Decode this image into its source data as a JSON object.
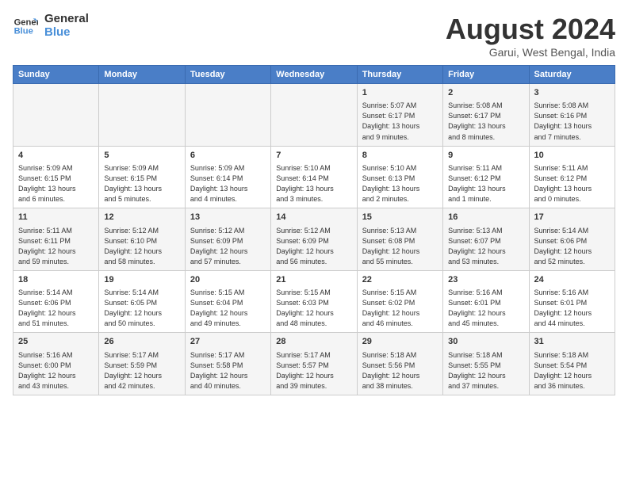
{
  "logo": {
    "line1": "General",
    "line2": "Blue"
  },
  "title": "August 2024",
  "subtitle": "Garui, West Bengal, India",
  "days_of_week": [
    "Sunday",
    "Monday",
    "Tuesday",
    "Wednesday",
    "Thursday",
    "Friday",
    "Saturday"
  ],
  "weeks": [
    [
      {
        "day": "",
        "content": ""
      },
      {
        "day": "",
        "content": ""
      },
      {
        "day": "",
        "content": ""
      },
      {
        "day": "",
        "content": ""
      },
      {
        "day": "1",
        "content": "Sunrise: 5:07 AM\nSunset: 6:17 PM\nDaylight: 13 hours\nand 9 minutes."
      },
      {
        "day": "2",
        "content": "Sunrise: 5:08 AM\nSunset: 6:17 PM\nDaylight: 13 hours\nand 8 minutes."
      },
      {
        "day": "3",
        "content": "Sunrise: 5:08 AM\nSunset: 6:16 PM\nDaylight: 13 hours\nand 7 minutes."
      }
    ],
    [
      {
        "day": "4",
        "content": "Sunrise: 5:09 AM\nSunset: 6:15 PM\nDaylight: 13 hours\nand 6 minutes."
      },
      {
        "day": "5",
        "content": "Sunrise: 5:09 AM\nSunset: 6:15 PM\nDaylight: 13 hours\nand 5 minutes."
      },
      {
        "day": "6",
        "content": "Sunrise: 5:09 AM\nSunset: 6:14 PM\nDaylight: 13 hours\nand 4 minutes."
      },
      {
        "day": "7",
        "content": "Sunrise: 5:10 AM\nSunset: 6:14 PM\nDaylight: 13 hours\nand 3 minutes."
      },
      {
        "day": "8",
        "content": "Sunrise: 5:10 AM\nSunset: 6:13 PM\nDaylight: 13 hours\nand 2 minutes."
      },
      {
        "day": "9",
        "content": "Sunrise: 5:11 AM\nSunset: 6:12 PM\nDaylight: 13 hours\nand 1 minute."
      },
      {
        "day": "10",
        "content": "Sunrise: 5:11 AM\nSunset: 6:12 PM\nDaylight: 13 hours\nand 0 minutes."
      }
    ],
    [
      {
        "day": "11",
        "content": "Sunrise: 5:11 AM\nSunset: 6:11 PM\nDaylight: 12 hours\nand 59 minutes."
      },
      {
        "day": "12",
        "content": "Sunrise: 5:12 AM\nSunset: 6:10 PM\nDaylight: 12 hours\nand 58 minutes."
      },
      {
        "day": "13",
        "content": "Sunrise: 5:12 AM\nSunset: 6:09 PM\nDaylight: 12 hours\nand 57 minutes."
      },
      {
        "day": "14",
        "content": "Sunrise: 5:12 AM\nSunset: 6:09 PM\nDaylight: 12 hours\nand 56 minutes."
      },
      {
        "day": "15",
        "content": "Sunrise: 5:13 AM\nSunset: 6:08 PM\nDaylight: 12 hours\nand 55 minutes."
      },
      {
        "day": "16",
        "content": "Sunrise: 5:13 AM\nSunset: 6:07 PM\nDaylight: 12 hours\nand 53 minutes."
      },
      {
        "day": "17",
        "content": "Sunrise: 5:14 AM\nSunset: 6:06 PM\nDaylight: 12 hours\nand 52 minutes."
      }
    ],
    [
      {
        "day": "18",
        "content": "Sunrise: 5:14 AM\nSunset: 6:06 PM\nDaylight: 12 hours\nand 51 minutes."
      },
      {
        "day": "19",
        "content": "Sunrise: 5:14 AM\nSunset: 6:05 PM\nDaylight: 12 hours\nand 50 minutes."
      },
      {
        "day": "20",
        "content": "Sunrise: 5:15 AM\nSunset: 6:04 PM\nDaylight: 12 hours\nand 49 minutes."
      },
      {
        "day": "21",
        "content": "Sunrise: 5:15 AM\nSunset: 6:03 PM\nDaylight: 12 hours\nand 48 minutes."
      },
      {
        "day": "22",
        "content": "Sunrise: 5:15 AM\nSunset: 6:02 PM\nDaylight: 12 hours\nand 46 minutes."
      },
      {
        "day": "23",
        "content": "Sunrise: 5:16 AM\nSunset: 6:01 PM\nDaylight: 12 hours\nand 45 minutes."
      },
      {
        "day": "24",
        "content": "Sunrise: 5:16 AM\nSunset: 6:01 PM\nDaylight: 12 hours\nand 44 minutes."
      }
    ],
    [
      {
        "day": "25",
        "content": "Sunrise: 5:16 AM\nSunset: 6:00 PM\nDaylight: 12 hours\nand 43 minutes."
      },
      {
        "day": "26",
        "content": "Sunrise: 5:17 AM\nSunset: 5:59 PM\nDaylight: 12 hours\nand 42 minutes."
      },
      {
        "day": "27",
        "content": "Sunrise: 5:17 AM\nSunset: 5:58 PM\nDaylight: 12 hours\nand 40 minutes."
      },
      {
        "day": "28",
        "content": "Sunrise: 5:17 AM\nSunset: 5:57 PM\nDaylight: 12 hours\nand 39 minutes."
      },
      {
        "day": "29",
        "content": "Sunrise: 5:18 AM\nSunset: 5:56 PM\nDaylight: 12 hours\nand 38 minutes."
      },
      {
        "day": "30",
        "content": "Sunrise: 5:18 AM\nSunset: 5:55 PM\nDaylight: 12 hours\nand 37 minutes."
      },
      {
        "day": "31",
        "content": "Sunrise: 5:18 AM\nSunset: 5:54 PM\nDaylight: 12 hours\nand 36 minutes."
      }
    ]
  ]
}
